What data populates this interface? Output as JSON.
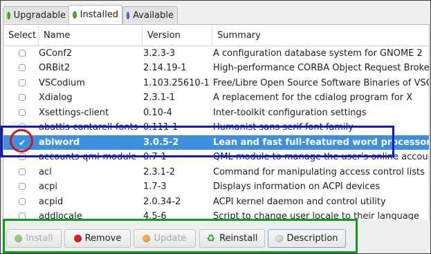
{
  "tabs": [
    {
      "label": "Upgradable",
      "color": "#5cae2f"
    },
    {
      "label": "Installed",
      "color": "#5cae2f"
    },
    {
      "label": "Available",
      "color": "#2e78d8"
    }
  ],
  "table": {
    "headers": {
      "select": "Select",
      "name": "Name",
      "version": "Version",
      "summary": "Summary"
    },
    "rows": [
      {
        "name": "GConf2",
        "version": "3.2.3-3",
        "summary": "A configuration database system for GNOME 2",
        "selected": false
      },
      {
        "name": "ORBit2",
        "version": "2.14.19-1",
        "summary": "High-performance CORBA Object Request Broker",
        "selected": false
      },
      {
        "name": "VSCodium",
        "version": "1.103.25610-1",
        "summary": "Free/Libre Open Source Software Binaries of VSCode",
        "selected": false
      },
      {
        "name": "Xdialog",
        "version": "2.3.1-1",
        "summary": "A replacement for the cdialog program for X",
        "selected": false
      },
      {
        "name": "Xsettings-client",
        "version": "0.10-4",
        "summary": "Inter-toolkit configuration settings",
        "selected": false
      },
      {
        "name": "abattis-cantarell-fonts",
        "version": "0.111-1",
        "summary": "Humanist sans serif font family",
        "selected": false
      },
      {
        "name": "abiword",
        "version": "3.0.5-2",
        "summary": "Lean and fast full-featured word processor",
        "selected": true
      },
      {
        "name": "accounts-qml-module",
        "version": "0.7-1",
        "summary": "QML module to manage the user's online accounts",
        "selected": false
      },
      {
        "name": "acl",
        "version": "2.3.1-2",
        "summary": "Command for manipulating access control lists",
        "selected": false
      },
      {
        "name": "acpi",
        "version": "1.7-3",
        "summary": "Displays information on ACPI devices",
        "selected": false
      },
      {
        "name": "acpid",
        "version": "2.0.34-2",
        "summary": "ACPI kernel daemon and control utility",
        "selected": false
      },
      {
        "name": "addlocale",
        "version": "4.5-6",
        "summary": "Script to change user locale to their language",
        "selected": false
      }
    ]
  },
  "buttons": {
    "install": {
      "label": "Install",
      "color": "#5cae2f"
    },
    "remove": {
      "label": "Remove",
      "color": "#e02020"
    },
    "update": {
      "label": "Update",
      "color": "#f08c1e"
    },
    "reinstall": {
      "label": "Reinstall",
      "icon": "recycle-icon"
    },
    "description": {
      "label": "Description",
      "color": "#dcdcdc"
    }
  },
  "annotation_colors": {
    "row_box": "#0b17c8",
    "checkbox_circle": "#d21414",
    "buttons_box": "#0a9e1e"
  }
}
